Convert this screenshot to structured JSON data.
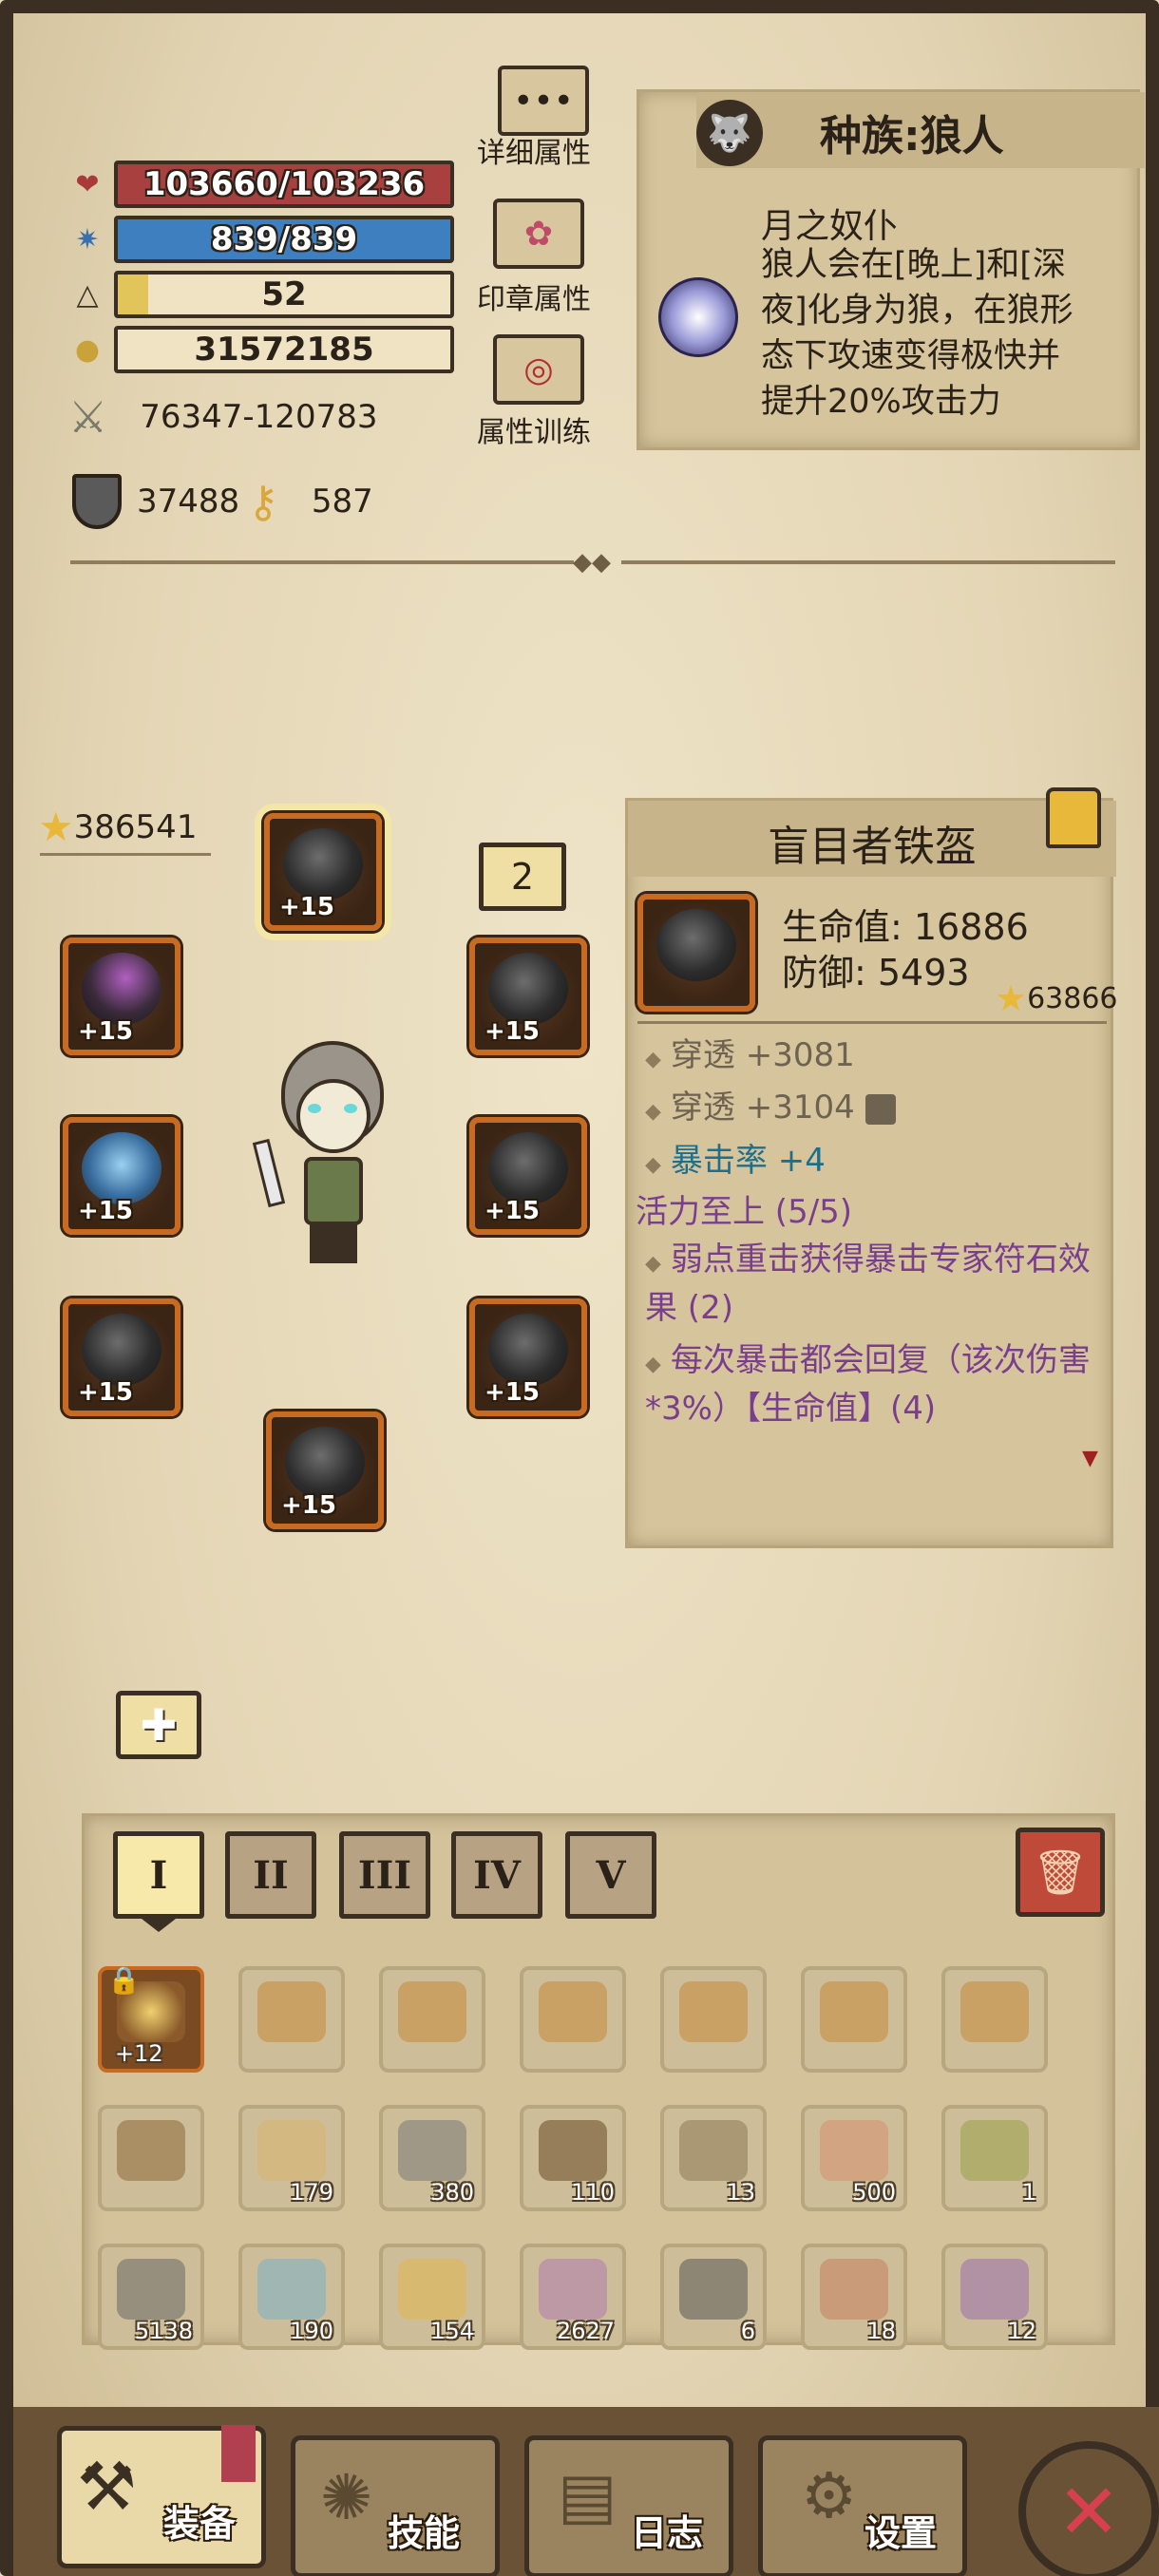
{
  "stats": {
    "hp": "103660/103236",
    "mana": "839/839",
    "level": "52",
    "gold": "31572185",
    "attack": "76347-120783",
    "defense": "37488",
    "keys": "587"
  },
  "side_buttons": [
    {
      "label": "详细属性",
      "icon": "dots-icon"
    },
    {
      "label": "印章属性",
      "icon": "flower-icon"
    },
    {
      "label": "属性训练",
      "icon": "target-icon"
    }
  ],
  "race": {
    "title": "种族:狼人",
    "trait_name": "月之奴仆",
    "trait_desc_lines": [
      "狼人会在[晚上]和[深",
      "夜]化身为狼，在狼形",
      "态下攻速变得极快并",
      "提升20%攻击力"
    ]
  },
  "equipment": {
    "total_score": "386541",
    "page_indicator": "2",
    "slots": [
      {
        "name": "helmet-slot",
        "level": "+15"
      },
      {
        "name": "amulet-slot",
        "level": "+15"
      },
      {
        "name": "necklace-slot",
        "level": "+15"
      },
      {
        "name": "wings-slot",
        "level": "+15"
      },
      {
        "name": "shoulder-slot",
        "level": "+15"
      },
      {
        "name": "gloves-slot",
        "level": "+15"
      },
      {
        "name": "armor-slot",
        "level": "+15"
      },
      {
        "name": "boots-slot",
        "level": "+15"
      }
    ]
  },
  "item_detail": {
    "title": "盲目者铁盔",
    "hp": "生命值: 16886",
    "defense": "防御: 5493",
    "score": "63866",
    "attributes": [
      "穿透 +3081",
      "穿透 +3104",
      "暴击率 +4"
    ],
    "set_name": "活力至上 (5/5)",
    "set_bonuses": [
      "弱点重击获得暴击专家符石效果 (2)",
      "每次暴击都会回复（该次伤害*3%）【生命值】(4)"
    ]
  },
  "inventory": {
    "tabs": [
      "I",
      "II",
      "III",
      "IV",
      "V"
    ],
    "row1": [
      {
        "count": "+12",
        "color": "#c98a3a"
      },
      {
        "count": "",
        "color": "#c98a3a"
      },
      {
        "count": "",
        "color": "#c98a3a"
      },
      {
        "count": "",
        "color": "#c98a3a"
      },
      {
        "count": "",
        "color": "#c98a3a"
      },
      {
        "count": "",
        "color": "#c98a3a"
      },
      {
        "count": "",
        "color": "#c98a3a"
      }
    ],
    "row2": [
      {
        "count": "",
        "color": "#8e6a3a"
      },
      {
        "count": "179",
        "color": "#d8b470"
      },
      {
        "count": "380",
        "color": "#7a7a7a"
      },
      {
        "count": "110",
        "color": "#6a4a2a"
      },
      {
        "count": "13",
        "color": "#8e7a5a"
      },
      {
        "count": "500",
        "color": "#d89070"
      },
      {
        "count": "1",
        "color": "#9aa04a"
      }
    ],
    "row3": [
      {
        "count": "5138",
        "color": "#6a6a6a"
      },
      {
        "count": "190",
        "color": "#7ab0c8"
      },
      {
        "count": "154",
        "color": "#e0b850"
      },
      {
        "count": "2627",
        "color": "#b07ab0"
      },
      {
        "count": "6",
        "color": "#5a5a5a"
      },
      {
        "count": "18",
        "color": "#c88060"
      },
      {
        "count": "12",
        "color": "#9a70b0"
      }
    ]
  },
  "nav": {
    "equip": "装备",
    "skills": "技能",
    "log": "日志",
    "settings": "设置"
  }
}
